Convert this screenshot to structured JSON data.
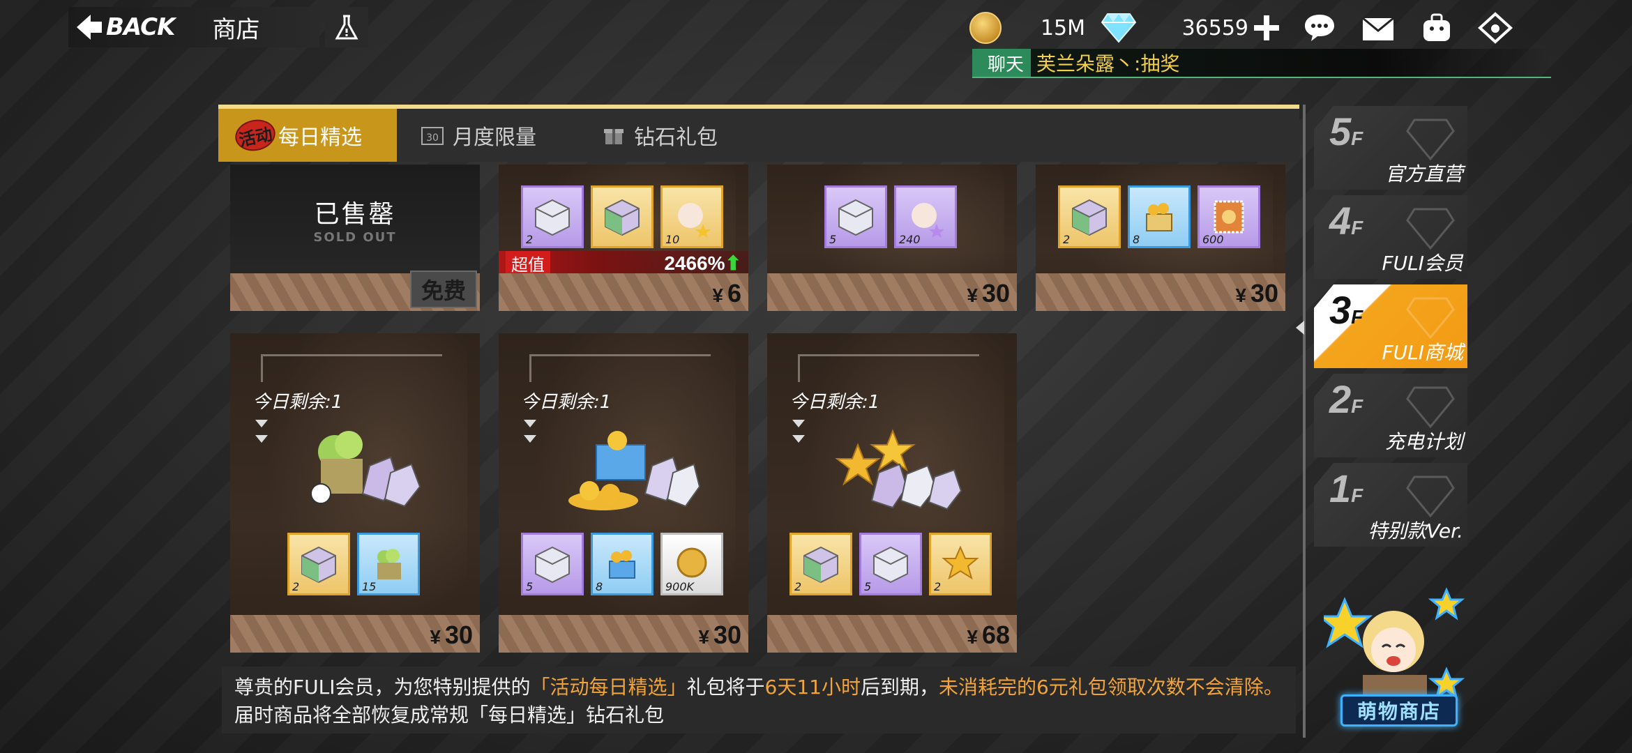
{
  "header": {
    "back_label": "BACK",
    "title": "商店",
    "coins": "15M",
    "gems": "36559"
  },
  "chat": {
    "tag": "聊天",
    "message": "芙兰朵露丶:抽奖"
  },
  "tabs": [
    {
      "badge": "活动",
      "label": "每日精选",
      "active": true
    },
    {
      "label": "月度限量",
      "icon": "calendar-30-icon"
    },
    {
      "label": "钻石礼包",
      "icon": "gift-box-icon"
    }
  ],
  "cards_top": [
    {
      "sold_title": "已售罄",
      "sold_sub": "SOLD OUT",
      "free_label": "免费"
    },
    {
      "items": [
        {
          "count": "2",
          "rarity": "purple"
        },
        {
          "count": "",
          "rarity": "gold"
        },
        {
          "count": "10",
          "rarity": "gold"
        }
      ],
      "value_tag": "超值",
      "value_pct": "2466%",
      "price": "6"
    },
    {
      "items": [
        {
          "count": "5",
          "rarity": "purple"
        },
        {
          "count": "240",
          "rarity": "purple"
        }
      ],
      "price": "30"
    },
    {
      "items": [
        {
          "count": "2",
          "rarity": "gold"
        },
        {
          "count": "8",
          "rarity": "blue"
        },
        {
          "count": "600",
          "rarity": "purple"
        }
      ],
      "price": "30"
    }
  ],
  "cards_bottom": [
    {
      "remain": "今日剩余:1",
      "items": [
        {
          "count": "2",
          "rarity": "gold"
        },
        {
          "count": "15",
          "rarity": "blue"
        }
      ],
      "price": "30"
    },
    {
      "remain": "今日剩余:1",
      "items": [
        {
          "count": "5",
          "rarity": "purple"
        },
        {
          "count": "8",
          "rarity": "blue"
        },
        {
          "count": "900K",
          "rarity": "white"
        }
      ],
      "price": "30"
    },
    {
      "remain": "今日剩余:1",
      "items": [
        {
          "count": "2",
          "rarity": "gold"
        },
        {
          "count": "5",
          "rarity": "purple"
        },
        {
          "count": "2",
          "rarity": "gold"
        }
      ],
      "price": "68"
    }
  ],
  "currency_symbol": "¥",
  "notice": {
    "p1": "尊贵的FULI会员，为您特别提供的",
    "h1": "「活动每日精选」",
    "p2": "礼包将于",
    "h2": "6天11小时",
    "p3": "后到期，",
    "h3": "未消耗完的6元礼包领取次数不会清除。",
    "p4": "届时商品将全部恢复成常规「每日精选」钻石礼包"
  },
  "floors": [
    {
      "num": "5",
      "suffix": "F",
      "label": "官方直营"
    },
    {
      "num": "4",
      "suffix": "F",
      "label": "FULI会员"
    },
    {
      "num": "3",
      "suffix": "F",
      "label": "FULI商城",
      "active": true
    },
    {
      "num": "2",
      "suffix": "F",
      "label": "充电计划"
    },
    {
      "num": "1",
      "suffix": "F",
      "label": "特别款Ver."
    }
  ],
  "mascot_button": "萌物商店",
  "colors": {
    "accent": "#c8961a",
    "active_floor": "#f4a51c",
    "highlight": "#f2a43a",
    "chat_green": "#2d8a5a"
  }
}
